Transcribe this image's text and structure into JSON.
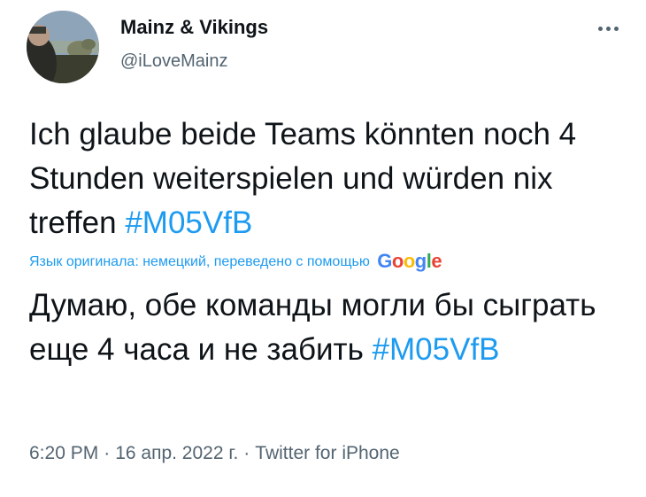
{
  "author": {
    "name": "Mainz & Vikings",
    "handle": "@iLoveMainz"
  },
  "tweet": {
    "text_main": "Ich glaube beide Teams könnten noch 4 Stunden weiterspielen und würden nix treffen",
    "hashtag": "#M05VfB",
    "translation_label": "Язык оригинала: немецкий, переведено с помощью",
    "translation_provider": "Google",
    "translated_main": "Думаю, обе команды могли бы сыграть еще 4 часа и не забить",
    "translated_hashtag": "#M05VfB"
  },
  "meta": {
    "time": "6:20 PM",
    "separator": "·",
    "date": "16 апр. 2022 г.",
    "source": "Twitter for iPhone"
  },
  "colors": {
    "text": "#0f1419",
    "secondary": "#536471",
    "link": "#1d9bf0",
    "google_blue": "#4285f4",
    "google_red": "#ea4335",
    "google_yellow": "#fbbc05",
    "google_green": "#34a853"
  },
  "icons": {
    "more": "more-horizontal-icon",
    "avatar": "profile-photo"
  }
}
